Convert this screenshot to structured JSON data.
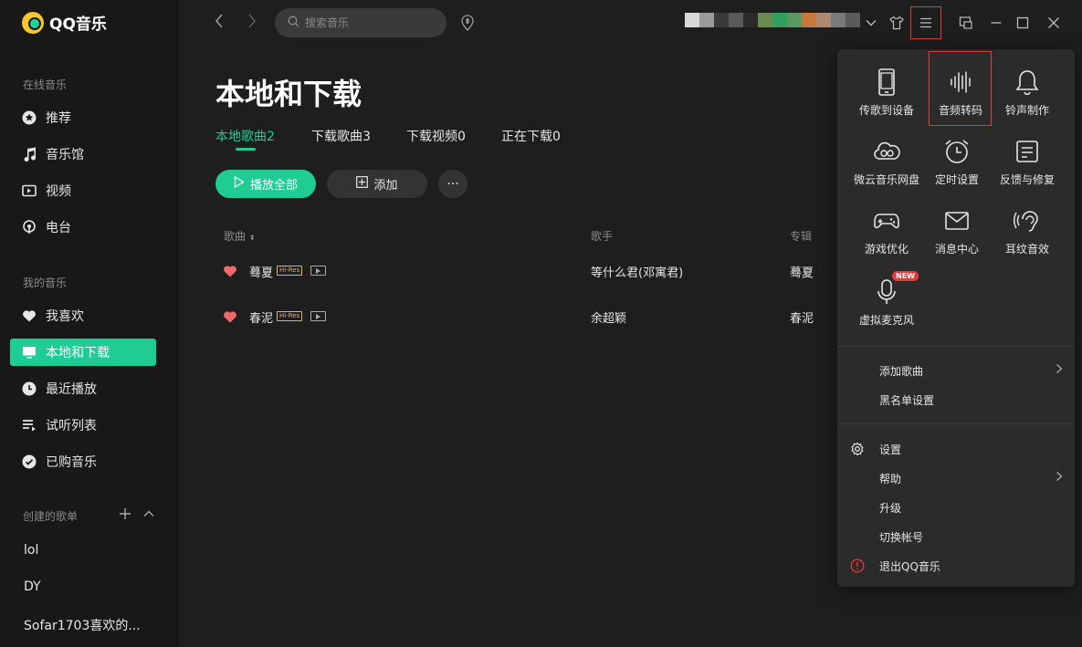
{
  "app": {
    "name": "QQ音乐"
  },
  "sidebar": {
    "online_title": "在线音乐",
    "online_items": [
      {
        "label": "推荐",
        "icon": "star-circle-icon"
      },
      {
        "label": "音乐馆",
        "icon": "music-note-icon"
      },
      {
        "label": "视频",
        "icon": "video-icon"
      },
      {
        "label": "电台",
        "icon": "radio-icon"
      }
    ],
    "mine_title": "我的音乐",
    "mine_items": [
      {
        "label": "我喜欢",
        "icon": "heart-icon"
      },
      {
        "label": "本地和下载",
        "icon": "monitor-icon",
        "active": true
      },
      {
        "label": "最近播放",
        "icon": "clock-icon"
      },
      {
        "label": "试听列表",
        "icon": "list-icon"
      },
      {
        "label": "已购音乐",
        "icon": "check-circle-icon"
      }
    ],
    "created_title": "创建的歌单",
    "playlists": [
      "lol",
      "DY",
      "Sofar1703喜欢的..."
    ]
  },
  "topbar": {
    "search_placeholder": "搜索音乐"
  },
  "main": {
    "title": "本地和下载",
    "tabs": [
      {
        "label": "本地歌曲2",
        "active": true
      },
      {
        "label": "下载歌曲3"
      },
      {
        "label": "下载视频0"
      },
      {
        "label": "正在下载0"
      }
    ],
    "play_all": "播放全部",
    "add": "添加",
    "more": "···",
    "columns": {
      "song": "歌曲",
      "singer": "歌手",
      "album": "专辑"
    },
    "songs": [
      {
        "name": "蓦夏",
        "badge": "Hi-Res",
        "singer": "等什么君(邓寓君)",
        "album": "蓦夏"
      },
      {
        "name": "春泥",
        "badge": "Hi-Res",
        "singer": "余超颖",
        "album": "春泥"
      }
    ]
  },
  "menu": {
    "grid": [
      {
        "label": "传歌到设备",
        "icon": "phone-icon"
      },
      {
        "label": "音频转码",
        "icon": "audio-wave-icon"
      },
      {
        "label": "铃声制作",
        "icon": "bell-icon"
      },
      {
        "label": "微云音乐网盘",
        "icon": "cloud-icon"
      },
      {
        "label": "定时设置",
        "icon": "alarm-clock-icon"
      },
      {
        "label": "反馈与修复",
        "icon": "feedback-icon"
      },
      {
        "label": "游戏优化",
        "icon": "gamepad-icon"
      },
      {
        "label": "消息中心",
        "icon": "mail-icon"
      },
      {
        "label": "耳纹音效",
        "icon": "ear-icon"
      },
      {
        "label": "虚拟麦克风",
        "icon": "microphone-icon",
        "badge": "NEW"
      }
    ],
    "list1": [
      {
        "label": "添加歌曲",
        "has_submenu": true
      },
      {
        "label": "黑名单设置"
      }
    ],
    "list2": [
      {
        "label": "设置",
        "icon": "gear-icon"
      },
      {
        "label": "帮助",
        "has_submenu": true
      },
      {
        "label": "升级"
      },
      {
        "label": "切换帐号"
      },
      {
        "label": "退出QQ音乐",
        "icon": "exit-warning-icon"
      }
    ]
  },
  "colors": {
    "accent": "#1ecc94",
    "highlight": "#e53a3a",
    "bg": "#1e1e1e",
    "sidebar": "#181818",
    "menu": "#2b2b2b"
  }
}
